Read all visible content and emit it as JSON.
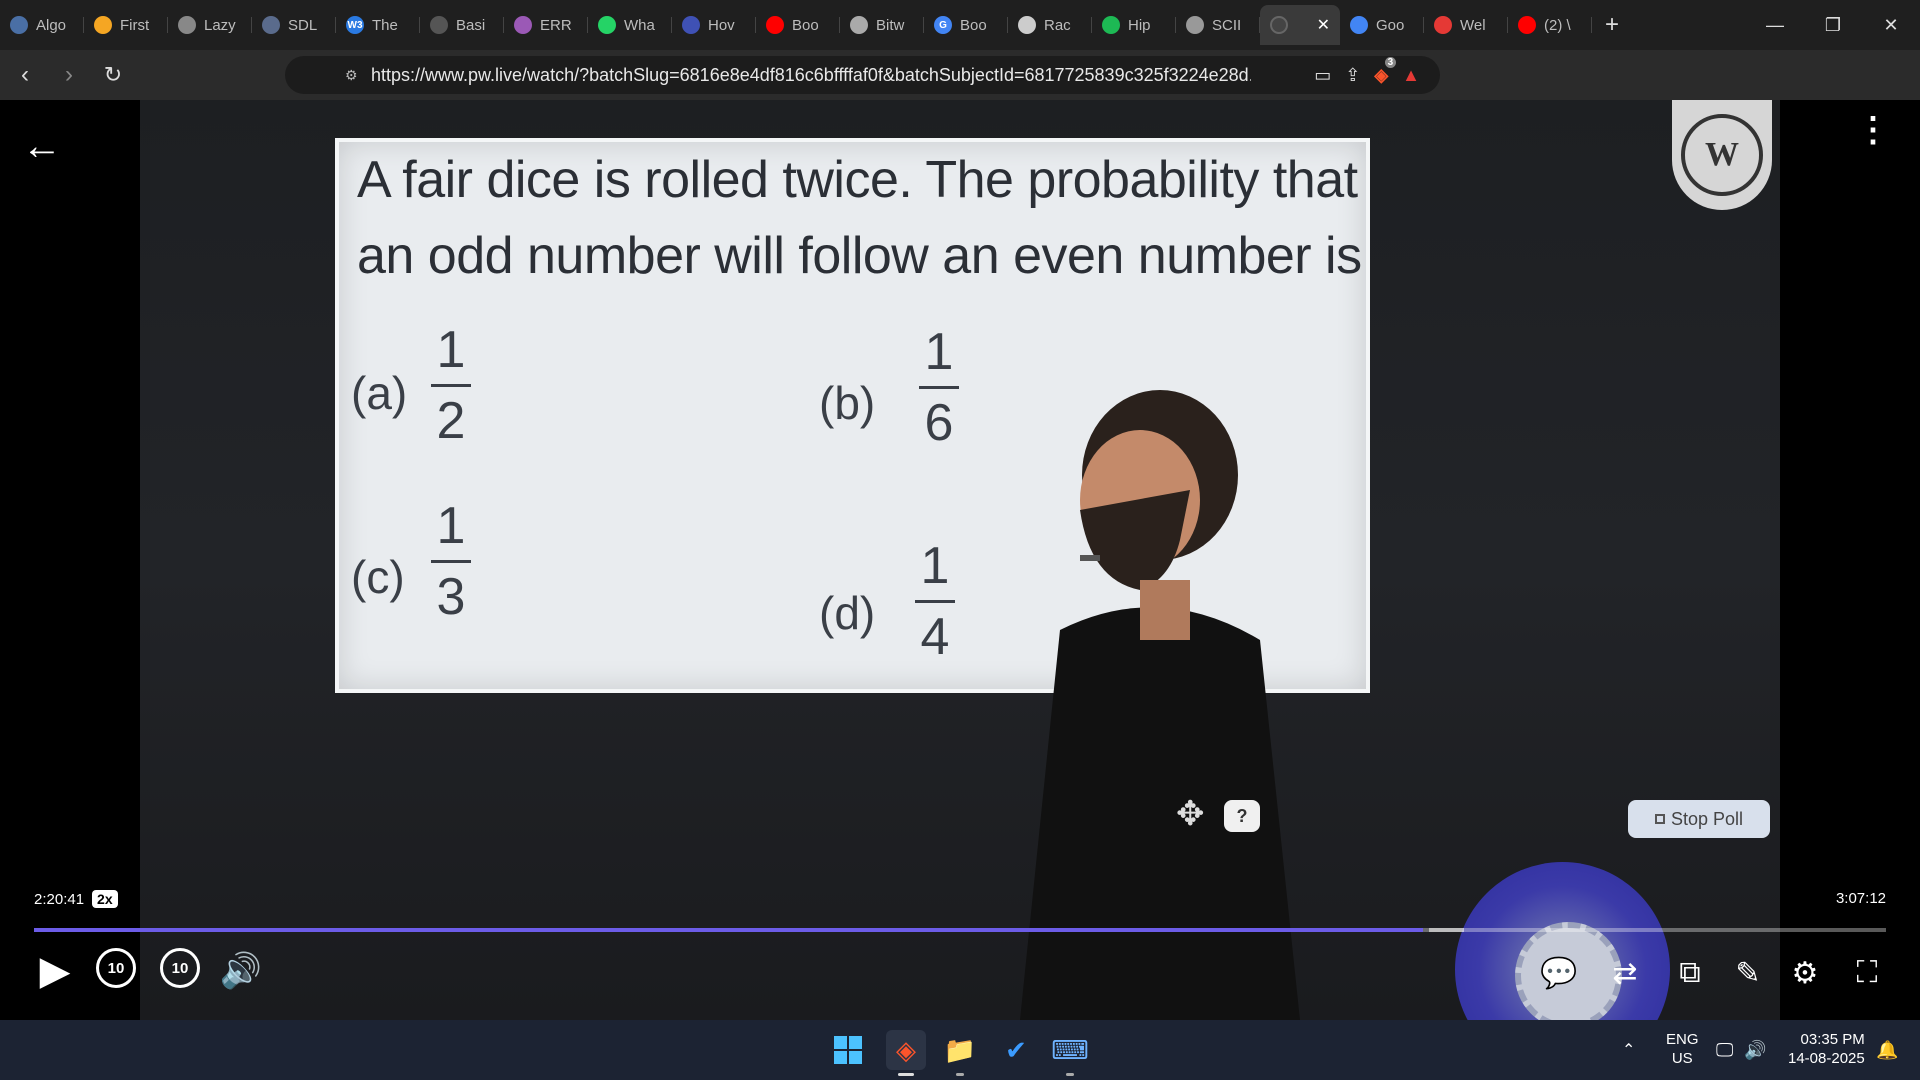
{
  "tabs": [
    {
      "label": "Algo",
      "color": "#4a6fa5",
      "icon": "globe-icon"
    },
    {
      "label": "First",
      "color": "#f5a623",
      "icon": "bolt-icon"
    },
    {
      "label": "Lazy",
      "color": "#888888",
      "icon": "globe-icon"
    },
    {
      "label": "SDL",
      "color": "#5a6b8c",
      "icon": "site-icon"
    },
    {
      "label": "The",
      "color": "#2a7ae2",
      "icon": "w3-icon",
      "glyph": "W3"
    },
    {
      "label": "Basi",
      "color": "#555555",
      "icon": "site-icon"
    },
    {
      "label": "ERR",
      "color": "#9b59b6",
      "icon": "brain-icon"
    },
    {
      "label": "Wha",
      "color": "#25d366",
      "icon": "whatsapp-icon"
    },
    {
      "label": "Hov",
      "color": "#3f51b5",
      "icon": "bookmark-icon"
    },
    {
      "label": "Boo",
      "color": "#ff0000",
      "icon": "youtube-icon"
    },
    {
      "label": "Bitw",
      "color": "#aaaaaa",
      "icon": "bitwise-icon"
    },
    {
      "label": "Boo",
      "color": "#4285f4",
      "icon": "google-icon",
      "glyph": "G"
    },
    {
      "label": "Rac",
      "color": "#cccccc",
      "icon": "openai-icon"
    },
    {
      "label": "Hip",
      "color": "#1db954",
      "icon": "spotify-icon"
    },
    {
      "label": "SCII",
      "color": "#999999",
      "icon": "globe-icon"
    }
  ],
  "tabs_after": [
    {
      "label": "Goo",
      "color": "#4285f4",
      "icon": "gemini-icon"
    },
    {
      "label": "Wel",
      "color": "#e53935",
      "icon": "site-icon"
    },
    {
      "label": "(2) \\",
      "color": "#ff0000",
      "icon": "youtube-icon"
    }
  ],
  "active_tab": {
    "close": "✕"
  },
  "url": "https://www.pw.live/watch/?batchSlug=6816e8e4df816c6bffffaf0f&batchSubjectId=6817725839c325f3224e28d...",
  "brave_badge": "3",
  "question": {
    "text": "A fair dice is rolled twice. The probability that an odd number will follow an even number is",
    "options": [
      {
        "label": "(a)",
        "num": "1",
        "den": "2"
      },
      {
        "label": "(b)",
        "num": "1",
        "den": "6"
      },
      {
        "label": "(c)",
        "num": "1",
        "den": "3"
      },
      {
        "label": "(d)",
        "num": "1",
        "den": "4"
      }
    ]
  },
  "logo_text": "W",
  "poll": {
    "label": "Stop Poll"
  },
  "help_label": "?",
  "player": {
    "current_time": "2:20:41",
    "speed": "2x",
    "duration": "3:07:12",
    "progress_fraction": 0.75,
    "rewind_label": "10",
    "forward_label": "10"
  },
  "taskbar": {
    "lang_top": "ENG",
    "lang_bottom": "US",
    "time": "03:35 PM",
    "date": "14-08-2025"
  }
}
